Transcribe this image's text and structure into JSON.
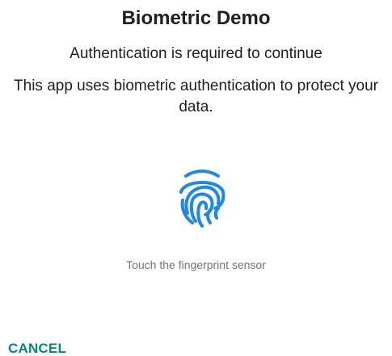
{
  "dialog": {
    "title": "Biometric Demo",
    "subtitle": "Authentication is required to continue",
    "description": "This app uses biometric authentication to protect your data.",
    "icon": "fingerprint-icon",
    "hint": "Touch the fingerprint sensor",
    "cancel_label": "CANCEL"
  },
  "colors": {
    "text_primary": "#212121",
    "text_secondary": "#757575",
    "fingerprint": "#1E88E5",
    "accent": "#00897B"
  }
}
